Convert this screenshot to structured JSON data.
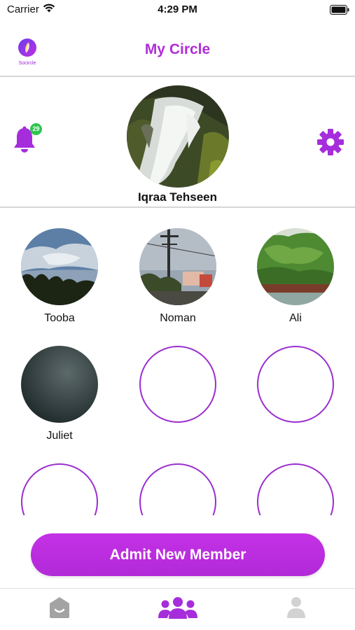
{
  "status_bar": {
    "carrier": "Carrier",
    "time": "4:29 PM"
  },
  "header": {
    "logo_text": "Socircle",
    "title": "My Circle"
  },
  "notifications": {
    "count": "29"
  },
  "profile": {
    "name": "Iqraa Tehseen"
  },
  "members": [
    {
      "name": "Tooba"
    },
    {
      "name": "Noman"
    },
    {
      "name": "Ali"
    },
    {
      "name": "Juliet"
    }
  ],
  "actions": {
    "admit_label": "Admit New Member"
  },
  "tabs": [
    {
      "icon": "home-icon",
      "active": false
    },
    {
      "icon": "group-icon",
      "active": true
    },
    {
      "icon": "profile-icon",
      "active": false
    }
  ],
  "colors": {
    "accent": "#b02ed8",
    "badge": "#2ec450",
    "inactive_tab": "#c8c8c8"
  }
}
